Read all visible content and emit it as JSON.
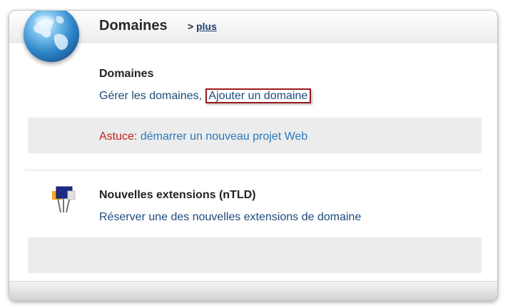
{
  "header": {
    "title": "Domaines",
    "more_prefix": ">",
    "more_link": "plus"
  },
  "domains_section": {
    "title": "Domaines",
    "manage_link": "Gérer les domaines",
    "separator": ",",
    "add_link": "Ajouter un domaine"
  },
  "tip": {
    "label": "Astuce:",
    "link": "démarrer un nouveau projet Web"
  },
  "ntld_section": {
    "title": "Nouvelles extensions (nTLD)",
    "link": "Réserver une des nouvelles extensions de domaine"
  },
  "icons": {
    "header_icon": "globe-icon",
    "ntld_icon": "flags-icon"
  },
  "colors": {
    "link": "#1c4a7a",
    "tip_label": "#c0201e",
    "tip_link": "#2a79bd",
    "highlight_border": "#9b1b1b"
  }
}
